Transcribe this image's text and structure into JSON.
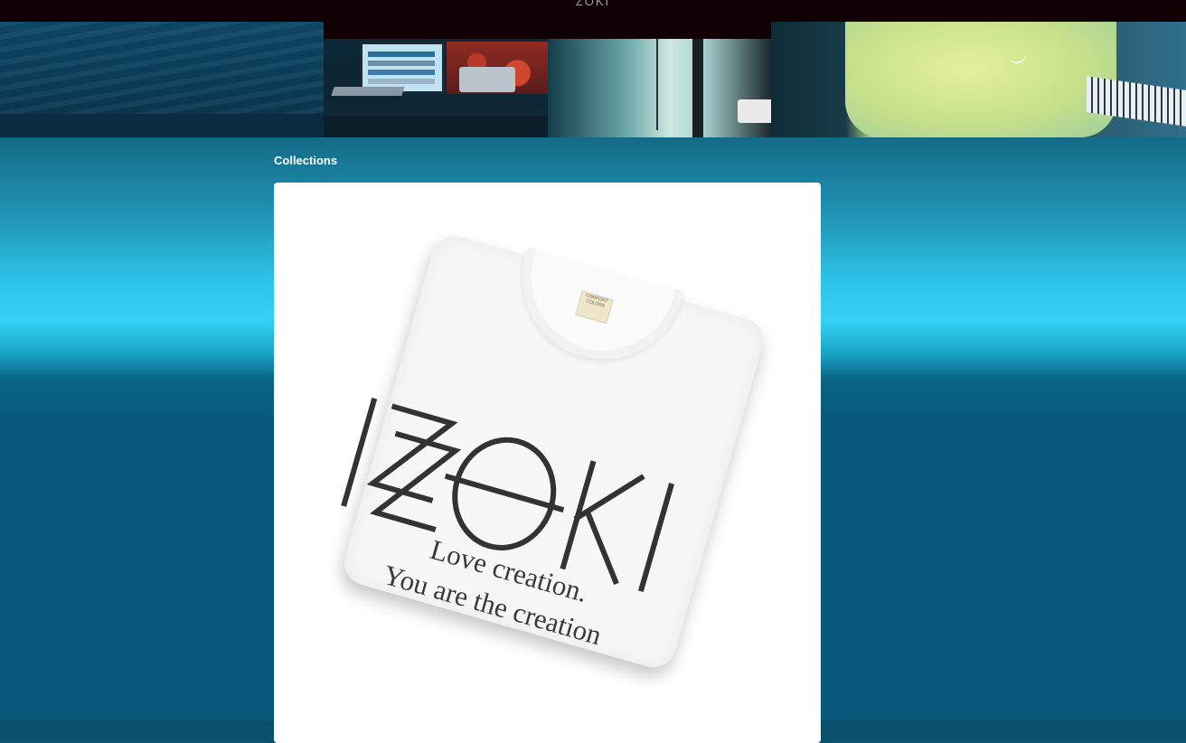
{
  "topbar": {
    "title": "ZOKI"
  },
  "hero": {
    "panels": [
      {
        "name": "hero-panel-fabric"
      },
      {
        "name": "hero-panel-studio-desk"
      },
      {
        "name": "hero-panel-studio-gear"
      },
      {
        "name": "hero-panel-person"
      }
    ]
  },
  "collections": {
    "title": "Collections",
    "product": {
      "image_alt": "IZZOKI t-shirt",
      "logo_text": "IZZOKI",
      "tag_line_1": "Love creation.",
      "tag_line_2": "You are the creation",
      "label_text": "COMFORT COLORS"
    }
  },
  "colors": {
    "topbar": "#100004",
    "page_gradient_top": "#0b4f6a",
    "page_gradient_highlight": "#35d2f5",
    "page_gradient_bottom": "#07587a",
    "card": "#ffffff",
    "logo": "#333333"
  }
}
